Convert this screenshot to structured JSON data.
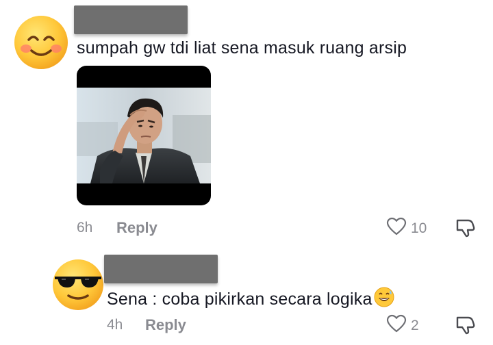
{
  "comments": [
    {
      "avatar_icon": "smiling-face-icon",
      "text": "sumpah gw tdi liat sena masuk ruang arsip",
      "media_icon": "man-headache-photo",
      "time": "6h",
      "reply_label": "Reply",
      "likes": "10"
    },
    {
      "avatar_icon": "sunglasses-face-icon",
      "text": "Sena : coba pikirkan secara logika",
      "inline_emoji": "grinning-sweat-icon",
      "time": "4h",
      "reply_label": "Reply",
      "likes": "2"
    }
  ],
  "colors": {
    "text": "#161823",
    "meta": "#8a8b91",
    "redaction": "#6f6f6f"
  }
}
